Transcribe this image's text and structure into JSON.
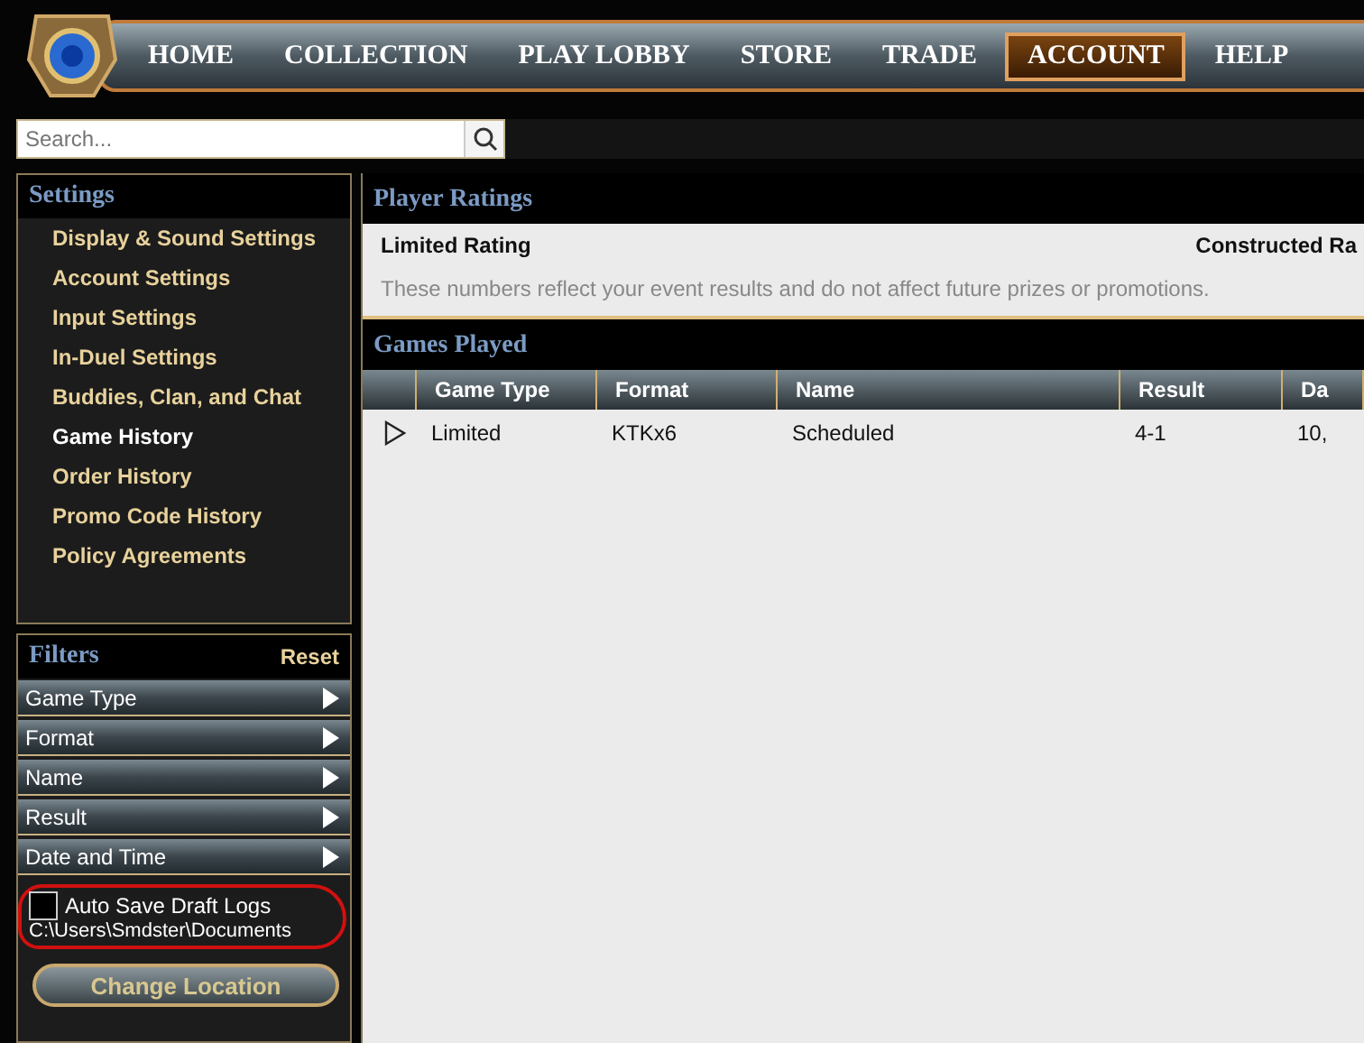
{
  "nav": [
    {
      "label": "HOME",
      "selected": false
    },
    {
      "label": "COLLECTION",
      "selected": false
    },
    {
      "label": "PLAY LOBBY",
      "selected": false
    },
    {
      "label": "STORE",
      "selected": false
    },
    {
      "label": "TRADE",
      "selected": false
    },
    {
      "label": "ACCOUNT",
      "selected": true
    },
    {
      "label": "HELP",
      "selected": false
    }
  ],
  "search": {
    "placeholder": "Search..."
  },
  "settings": {
    "title": "Settings",
    "items": [
      {
        "label": "Display & Sound Settings",
        "selected": false
      },
      {
        "label": "Account Settings",
        "selected": false
      },
      {
        "label": "Input Settings",
        "selected": false
      },
      {
        "label": "In-Duel Settings",
        "selected": false
      },
      {
        "label": "Buddies, Clan, and Chat",
        "selected": false
      },
      {
        "label": "Game History",
        "selected": true
      },
      {
        "label": "Order History",
        "selected": false
      },
      {
        "label": "Promo Code History",
        "selected": false
      },
      {
        "label": "Policy Agreements",
        "selected": false
      }
    ]
  },
  "filters": {
    "title": "Filters",
    "reset": "Reset",
    "items": [
      "Game Type",
      "Format",
      "Name",
      "Result",
      "Date and Time"
    ],
    "auto_save": {
      "label": "Auto Save Draft Logs",
      "checked": false,
      "path": "C:\\Users\\Smdster\\Documents"
    },
    "change_location": "Change Location"
  },
  "player_ratings": {
    "title": "Player Ratings",
    "limited": "Limited Rating",
    "constructed": "Constructed Ra",
    "note": "These numbers reflect your event results and do not affect future prizes or promotions."
  },
  "games_played": {
    "title": "Games Played",
    "columns": [
      "Game Type",
      "Format",
      "Name",
      "Result",
      "Da"
    ],
    "rows": [
      {
        "expanded": false,
        "cells": [
          "Limited",
          "KTKx6",
          "Scheduled",
          "4-1",
          "10,"
        ]
      }
    ]
  }
}
